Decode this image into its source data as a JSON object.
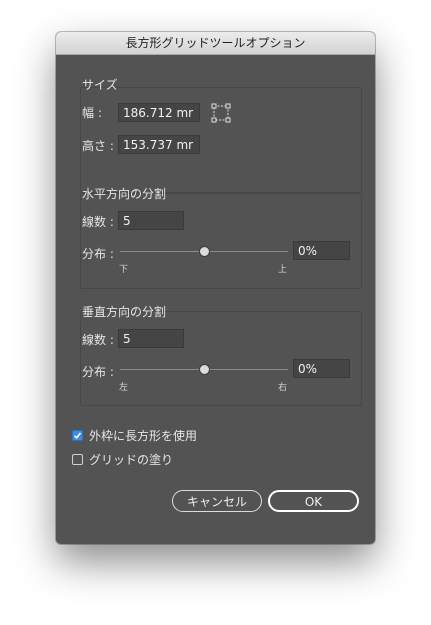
{
  "dialog": {
    "title": "長方形グリッドツールオプション"
  },
  "size": {
    "section_label": "サイズ",
    "width_label": "幅 :",
    "width_value": "186.712 mr",
    "height_label": "高さ :",
    "height_value": "153.737 mr"
  },
  "horizontal": {
    "section_label": "水平方向の分割",
    "count_label": "線数 :",
    "count_value": "5",
    "skew_label": "分布 :",
    "skew_value": "0%",
    "left_tick": "下",
    "right_tick": "上",
    "slider_level": 0.5
  },
  "vertical": {
    "section_label": "垂直方向の分割",
    "count_label": "線数 :",
    "count_value": "5",
    "skew_label": "分布 :",
    "skew_value": "0%",
    "left_tick": "左",
    "right_tick": "右",
    "slider_level": 0.5
  },
  "options": {
    "outer_rect_label": "外枠に長方形を使用",
    "outer_rect_checked": true,
    "fill_grid_label": "グリッドの塗り",
    "fill_grid_checked": false
  },
  "buttons": {
    "cancel": "キャンセル",
    "ok": "OK"
  },
  "colors": {
    "dialog_bg": "#535353",
    "checkbox_accent": "#3a8ee6",
    "field_bg": "#454545"
  }
}
